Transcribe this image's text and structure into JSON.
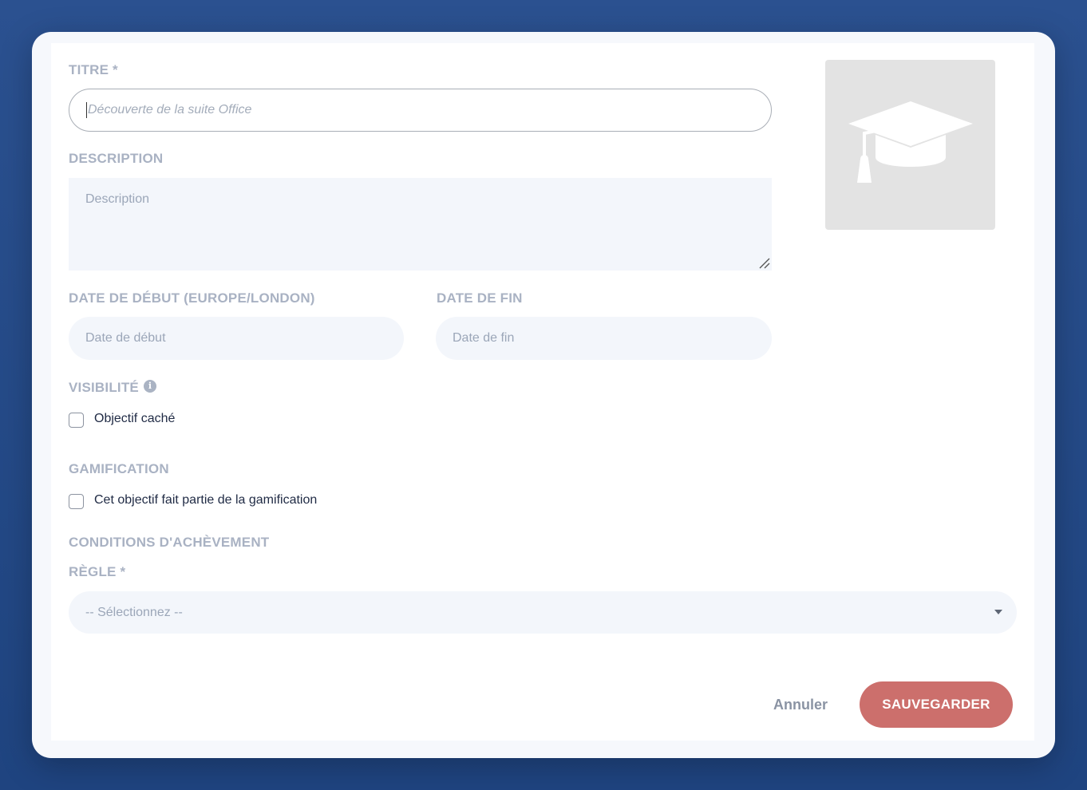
{
  "form": {
    "title": {
      "label": "TITRE *",
      "placeholder": "Découverte de la suite Office"
    },
    "description": {
      "label": "DESCRIPTION",
      "placeholder": "Description"
    },
    "start_date": {
      "label": "DATE DE DÉBUT (EUROPE/LONDON)",
      "placeholder": "Date de début"
    },
    "end_date": {
      "label": "DATE DE FIN",
      "placeholder": "Date de fin"
    },
    "visibility": {
      "label": "VISIBILITÉ",
      "info_icon": "info-icon",
      "checkbox_label": "Objectif caché",
      "checked": false
    },
    "gamification": {
      "label": "GAMIFICATION",
      "checkbox_label": "Cet objectif fait partie de la gamification",
      "checked": false
    },
    "completion": {
      "label": "CONDITIONS D'ACHÈVEMENT",
      "rule_label": "RÈGLE *",
      "rule_selected": "-- Sélectionnez --"
    }
  },
  "image": {
    "icon": "graduation-cap-icon",
    "background_color": "#e3e3e3"
  },
  "actions": {
    "cancel_label": "Annuler",
    "save_label": "SAUVEGARDER"
  },
  "colors": {
    "accent": "#cc6f6c",
    "background": "#2b5190"
  }
}
